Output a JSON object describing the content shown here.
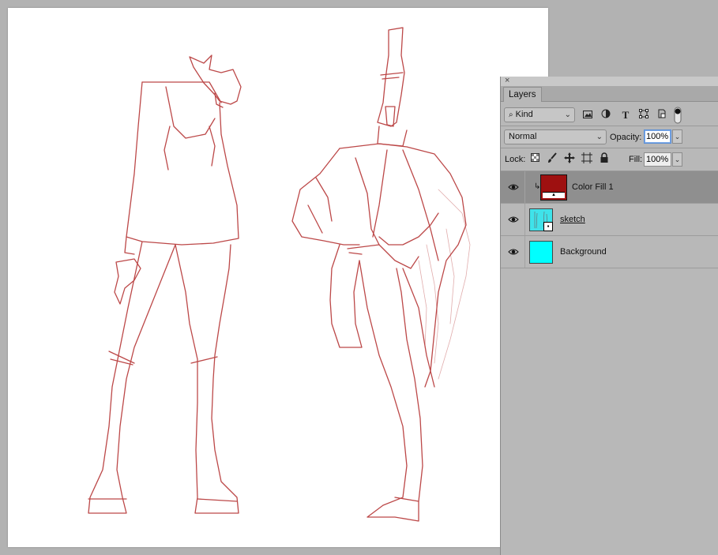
{
  "panel": {
    "tab_label": "Layers",
    "close_symbol": "×",
    "filter": {
      "value": "Kind",
      "search_icon": "search-icon"
    },
    "filter_icons": [
      "image-filter-icon",
      "adjustment-filter-icon",
      "type-filter-icon",
      "shape-filter-icon",
      "smart-object-filter-icon",
      "filter-toggle-icon"
    ],
    "blend_mode": "Normal",
    "opacity_label": "Opacity:",
    "opacity_value": "100%",
    "lock_label": "Lock:",
    "lock_icons": [
      "lock-transparent-icon",
      "lock-paint-icon",
      "lock-position-icon",
      "lock-artboard-icon",
      "lock-all-icon"
    ],
    "fill_label": "Fill:",
    "fill_value": "100%",
    "type_glyph": "T"
  },
  "layers": [
    {
      "name": "Color Fill 1",
      "selected": true,
      "thumb_color": "#9e1010",
      "clipped": true
    },
    {
      "name": "sketch",
      "selected": false,
      "thumb_color": "#3fe3ea",
      "smart_object": true
    },
    {
      "name": "Background",
      "selected": false,
      "thumb_color": "#00ffff"
    }
  ],
  "colors": {
    "sketch_line": "#b53535",
    "selection": "#8f8f8f",
    "canvas": "#ffffff",
    "workspace": "#b2b2b2"
  }
}
